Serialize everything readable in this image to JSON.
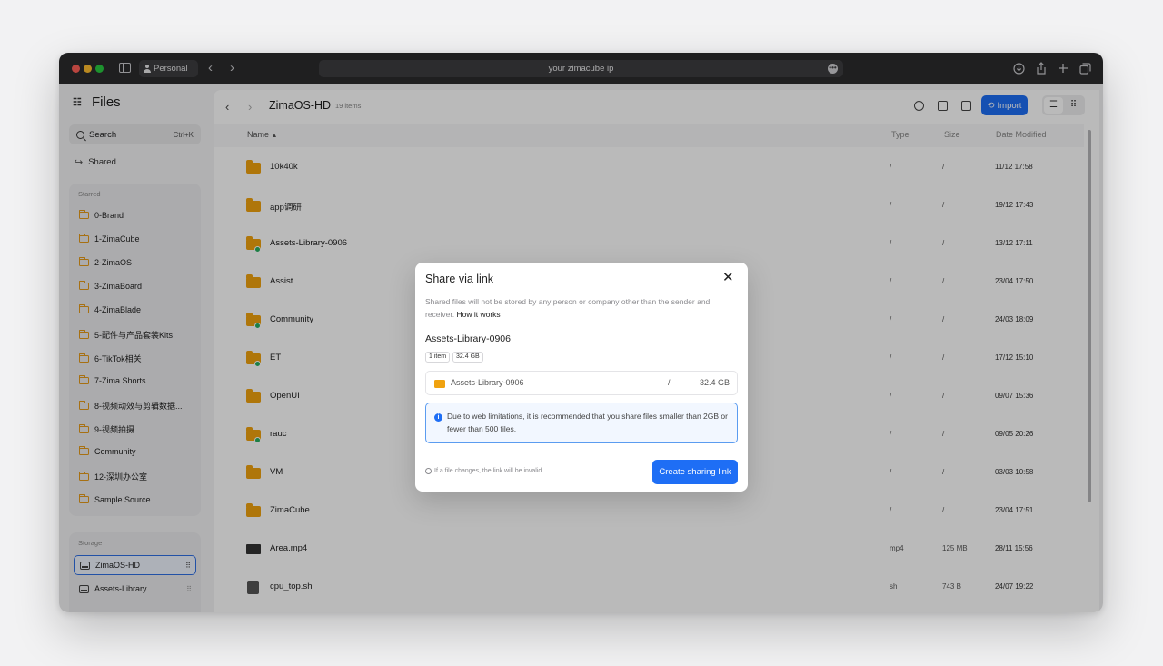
{
  "browser": {
    "profile": "Personal",
    "url": "your zimacube ip",
    "url_more": "•••"
  },
  "app": {
    "logo": "☷",
    "title": "Files",
    "search_label": "Search",
    "search_shortcut": "Ctrl+K",
    "shared_label": "Shared"
  },
  "starred": {
    "label": "Starred",
    "items": [
      "0-Brand",
      "1-ZimaCube",
      "2-ZimaOS",
      "3-ZimaBoard",
      "4-ZimaBlade",
      "5-配件与产品套装Kits",
      "6-TikTok相关",
      "7-Zima Shorts",
      "8-视频动效与剪辑数据...",
      "9-视频拍摄",
      "Community",
      "12-深圳办公室",
      "Sample Source"
    ]
  },
  "storage": {
    "label": "Storage",
    "items": [
      "ZimaOS-HD",
      "Assets-Library"
    ],
    "active": "ZimaOS-HD"
  },
  "main": {
    "title": "ZimaOS-HD",
    "count": "19 items",
    "import_label": "Import",
    "columns": {
      "name": "Name",
      "type": "Type",
      "size": "Size",
      "date": "Date Modified"
    },
    "rows": [
      {
        "name": "10k40k",
        "type": "/",
        "size": "/",
        "date": "11/12 17:58",
        "kind": "folder",
        "badge": false
      },
      {
        "name": "app调研",
        "type": "/",
        "size": "/",
        "date": "19/12 17:43",
        "kind": "folder",
        "badge": false
      },
      {
        "name": "Assets-Library-0906",
        "type": "/",
        "size": "/",
        "date": "13/12 17:11",
        "kind": "folder",
        "badge": true
      },
      {
        "name": "Assist",
        "type": "/",
        "size": "/",
        "date": "23/04 17:50",
        "kind": "folder",
        "badge": false
      },
      {
        "name": "Community",
        "type": "/",
        "size": "/",
        "date": "24/03 18:09",
        "kind": "folder",
        "badge": true
      },
      {
        "name": "ET",
        "type": "/",
        "size": "/",
        "date": "17/12 15:10",
        "kind": "folder",
        "badge": true
      },
      {
        "name": "OpenUI",
        "type": "/",
        "size": "/",
        "date": "09/07 15:36",
        "kind": "folder",
        "badge": false
      },
      {
        "name": "rauc",
        "type": "/",
        "size": "/",
        "date": "09/05 20:26",
        "kind": "folder",
        "badge": true
      },
      {
        "name": "VM",
        "type": "/",
        "size": "/",
        "date": "03/03 10:58",
        "kind": "folder",
        "badge": false
      },
      {
        "name": "ZimaCube",
        "type": "/",
        "size": "/",
        "date": "23/04 17:51",
        "kind": "folder",
        "badge": false
      },
      {
        "name": "Area.mp4",
        "type": "mp4",
        "size": "125 MB",
        "date": "28/11 15:56",
        "kind": "video",
        "badge": false
      },
      {
        "name": "cpu_top.sh",
        "type": "sh",
        "size": "743 B",
        "date": "24/07 19:22",
        "kind": "script",
        "badge": false
      }
    ]
  },
  "modal": {
    "title": "Share via link",
    "close": "✕",
    "desc": "Shared files will not be stored by any person or company other than the sender and receiver.",
    "desc_link": "How it works",
    "file_name": "Assets-Library-0906",
    "chip_items": "1 item",
    "chip_size": "32.4 GB",
    "box_name": "Assets-Library-0906",
    "box_sep": "/",
    "box_size": "32.4 GB",
    "info_text": "Due to web limitations, it is recommended that you share files smaller than 2GB or fewer than 500 files.",
    "footer_note": "If a file changes, the link will be invalid.",
    "create_label": "Create sharing link"
  },
  "colors": {
    "accent": "#1e6ef5",
    "folder": "#f0a20f",
    "synced": "#27ae60"
  }
}
